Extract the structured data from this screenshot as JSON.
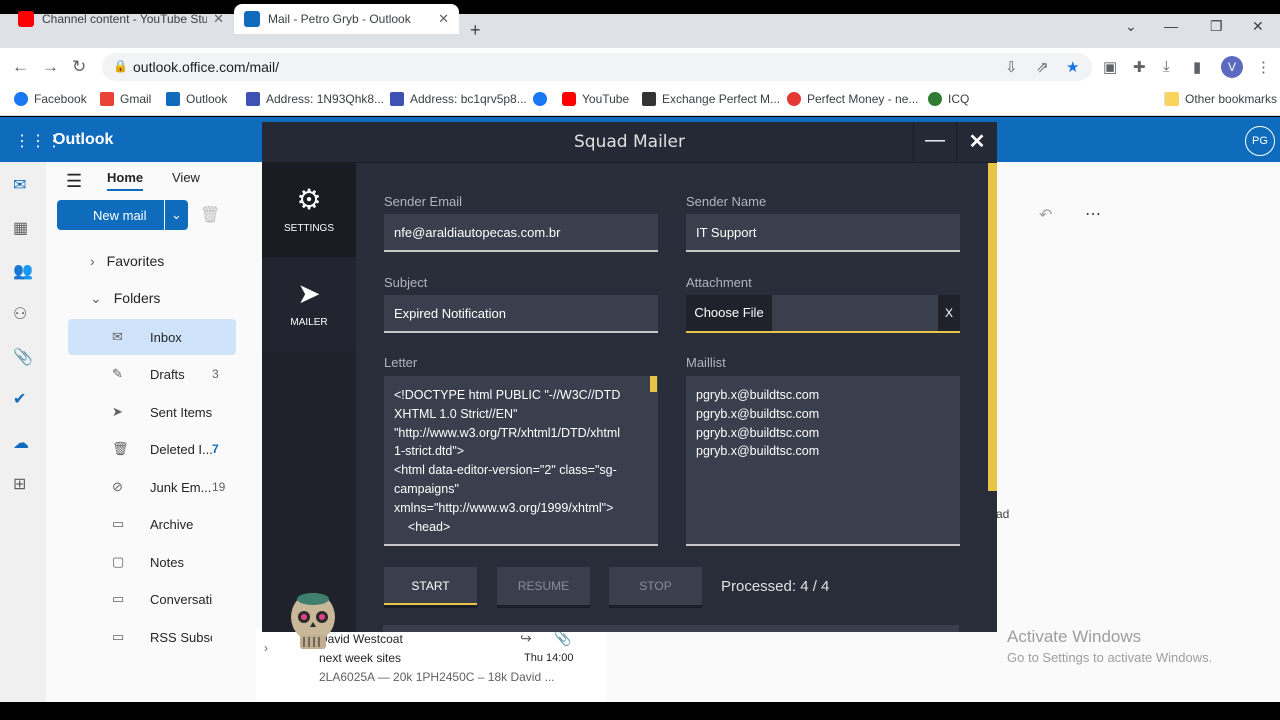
{
  "browser": {
    "tabs": [
      {
        "title": "Channel content - YouTube Studio",
        "icon": "youtube-icon",
        "color": "#ff0000"
      },
      {
        "title": "Mail - Petro Gryb - Outlook",
        "icon": "outlook-icon",
        "color": "#0f6cbd"
      }
    ],
    "url": "outlook.office.com/mail/",
    "profile_initial": "V",
    "bookmarks": [
      {
        "label": "Facebook",
        "color": "#1877f2"
      },
      {
        "label": "Gmail",
        "color": "#ea4335"
      },
      {
        "label": "Outlook",
        "color": "#0f6cbd"
      },
      {
        "label": "Address: 1N93Qhk8...",
        "color": "#3f51b5"
      },
      {
        "label": "Address: bc1qrv5p8...",
        "color": "#3f51b5"
      },
      {
        "label": "",
        "color": "#1877f2"
      },
      {
        "label": "YouTube",
        "color": "#ff0000"
      },
      {
        "label": "Exchange Perfect M...",
        "color": "#333333"
      },
      {
        "label": "Perfect Money - ne...",
        "color": "#e53935"
      },
      {
        "label": "ICQ",
        "color": "#2e7d32"
      }
    ],
    "other_bookmarks": "Other bookmarks"
  },
  "outlook": {
    "app_name": "Outlook",
    "user_initials": "PG",
    "ribbon_tabs": [
      "Home",
      "View"
    ],
    "new_mail": "New mail",
    "favorites": "Favorites",
    "folders": "Folders",
    "nav_items": [
      {
        "label": "Inbox",
        "count": "",
        "icon": "inbox-icon"
      },
      {
        "label": "Drafts",
        "count": "3",
        "icon": "drafts-icon"
      },
      {
        "label": "Sent Items",
        "count": "",
        "icon": "sent-icon"
      },
      {
        "label": "Deleted I...",
        "count": "7",
        "icon": "trash-icon"
      },
      {
        "label": "Junk Em...",
        "count": "19",
        "icon": "junk-icon"
      },
      {
        "label": "Archive",
        "count": "",
        "icon": "archive-icon"
      },
      {
        "label": "Notes",
        "count": "",
        "icon": "notes-icon"
      },
      {
        "label": "Conversati...",
        "count": "",
        "icon": "folder-icon"
      },
      {
        "label": "RSS Subscr...",
        "count": "",
        "icon": "folder-icon"
      }
    ],
    "message": {
      "sender": "David Westcoat",
      "subject": "next week sites",
      "time": "Thu 14:00",
      "preview": "2LA6025A — 20k 1PH2450C – 18k David ..."
    },
    "peek_text": "ad",
    "watermark": {
      "title": "Activate Windows",
      "subtitle": "Go to Settings to activate Windows."
    }
  },
  "mailer": {
    "title": "Squad Mailer",
    "nav": [
      {
        "label": "SETTINGS",
        "icon": "gears-icon"
      },
      {
        "label": "MAILER",
        "icon": "paper-plane-icon"
      }
    ],
    "sender_email_label": "Sender Email",
    "sender_email": "nfe@araldiautopecas.com.br",
    "sender_name_label": "Sender Name",
    "sender_name": "IT Support",
    "subject_label": "Subject",
    "subject": "Expired Notification",
    "attachment_label": "Attachment",
    "choose_file": "Choose File",
    "clear_attachment": "X",
    "letter_label": "Letter",
    "letter_lines": [
      "<!DOCTYPE html PUBLIC \"-//W3C//DTD",
      "XHTML 1.0 Strict//EN\"",
      "\"http://www.w3.org/TR/xhtml1/DTD/xhtml",
      "1-strict.dtd\">",
      "<html data-editor-version=\"2\" class=\"sg-",
      "campaigns\"",
      "xmlns=\"http://www.w3.org/1999/xhtml\">",
      "    <head>"
    ],
    "maillist_label": "Maillist",
    "maillist": [
      "pgryb.x@buildtsc.com",
      "pgryb.x@buildtsc.com",
      "pgryb.x@buildtsc.com",
      "pgryb.x@buildtsc.com"
    ],
    "start": "START",
    "resume": "RESUME",
    "stop": "STOP",
    "processed": "Processed: 4 / 4"
  }
}
